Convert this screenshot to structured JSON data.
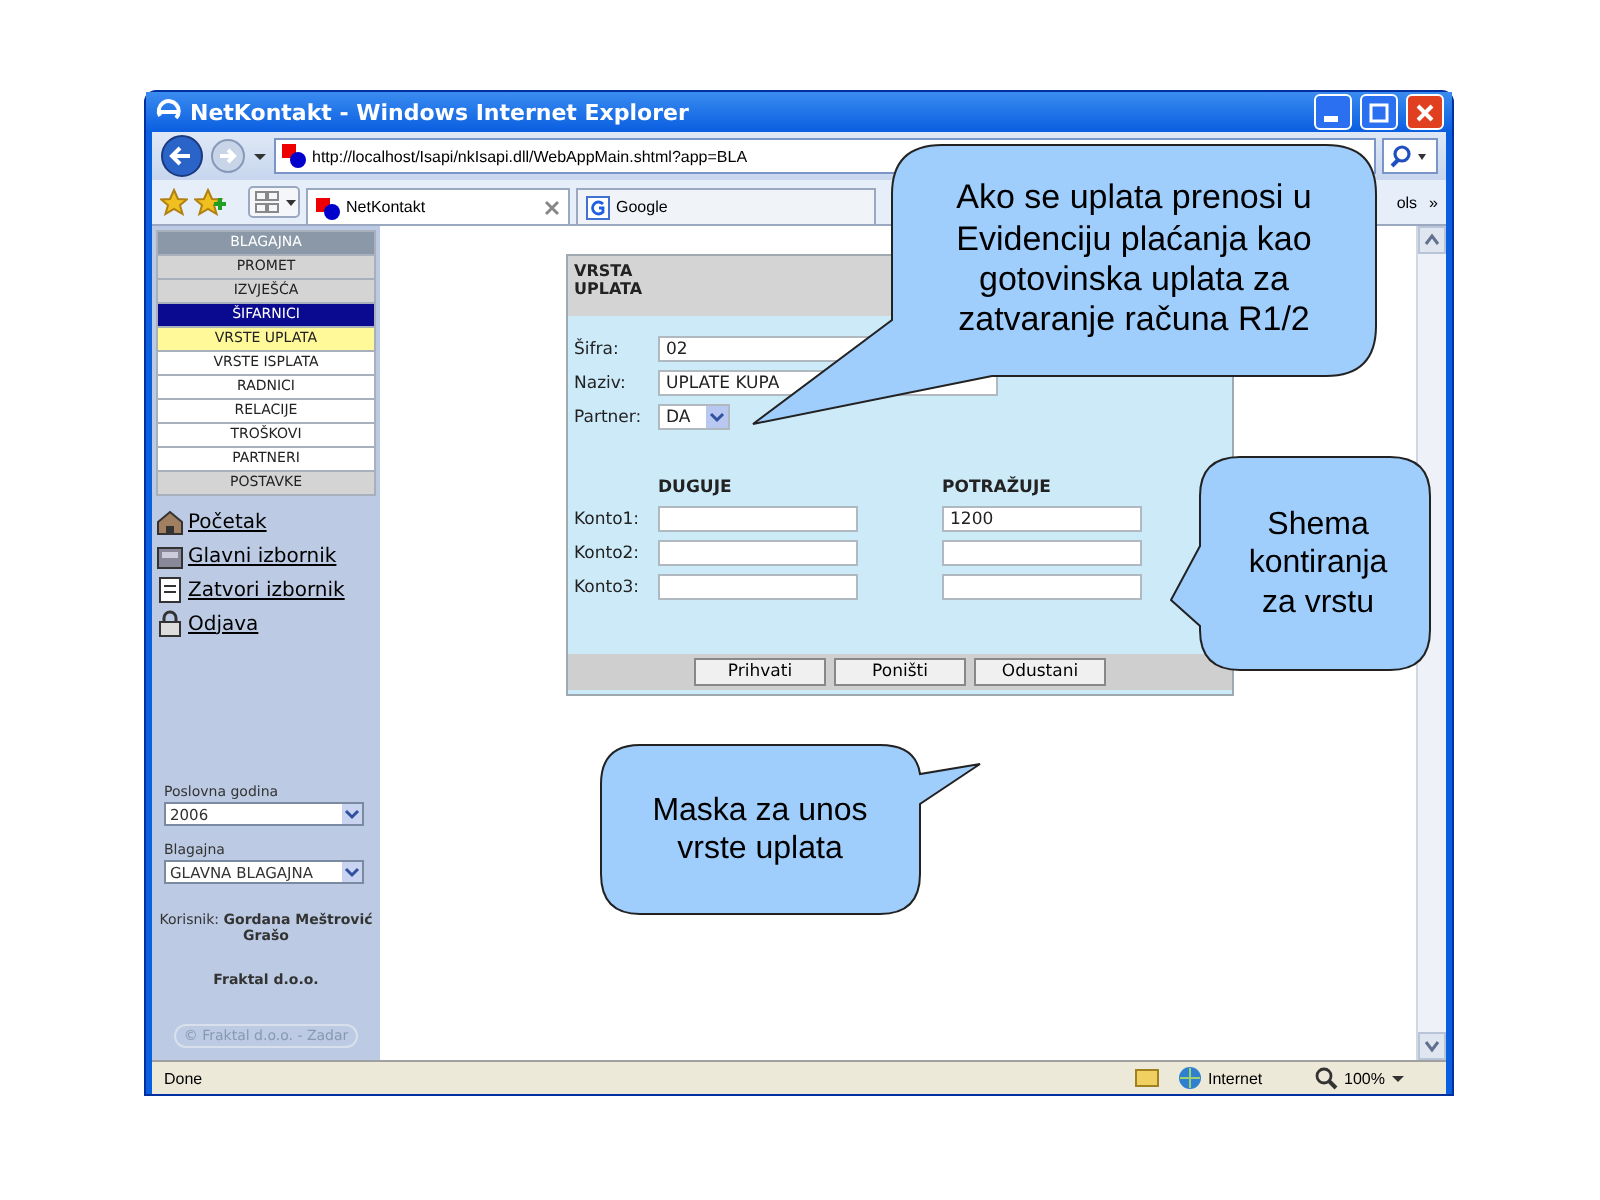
{
  "window": {
    "title": "NetKontakt - Windows Internet Explorer",
    "address": "http://localhost/Isapi/nkIsapi.dll/WebAppMain.shtml?app=BLA",
    "tabs": [
      {
        "label": "NetKontakt",
        "selected": true
      },
      {
        "label": "Google",
        "selected": false
      }
    ],
    "toolbar_text": "ols",
    "chevron": "»"
  },
  "sidebar": {
    "menu": [
      {
        "label": "BLAGAJNA",
        "kind": "header",
        "selected": false
      },
      {
        "label": "PROMET",
        "kind": "section",
        "selected": false
      },
      {
        "label": "IZVJEŠĆA",
        "kind": "section",
        "selected": false
      },
      {
        "label": "ŠIFARNICI",
        "kind": "section",
        "selected": true
      },
      {
        "label": "VRSTE UPLATA",
        "kind": "item",
        "selected": true
      },
      {
        "label": "VRSTE ISPLATA",
        "kind": "item",
        "selected": false
      },
      {
        "label": "RADNICI",
        "kind": "item",
        "selected": false
      },
      {
        "label": "RELACIJE",
        "kind": "item",
        "selected": false
      },
      {
        "label": "TROŠKOVI",
        "kind": "item",
        "selected": false
      },
      {
        "label": "PARTNERI",
        "kind": "item",
        "selected": false
      },
      {
        "label": "POSTAVKE",
        "kind": "section",
        "selected": false
      }
    ],
    "links": [
      {
        "label": "Početak",
        "kind": "home"
      },
      {
        "label": "Glavni izbornik",
        "kind": "menu"
      },
      {
        "label": "Zatvori izbornik",
        "kind": "close"
      },
      {
        "label": "Odjava",
        "kind": "logout"
      }
    ],
    "year": {
      "label": "Poslovna godina",
      "value": "2006"
    },
    "cashbox": {
      "label": "Blagajna",
      "value": "GLAVNA BLAGAJNA"
    },
    "user": "Korisnik: **Gordana Meštrović Grašo**",
    "company": "Fraktal d.o.o.",
    "copyright": "© Fraktal d.o.o. - Zadar"
  },
  "form": {
    "title": "VRSTA UPLATA",
    "fields": [
      {
        "label": "Šifra:",
        "value": "02",
        "kind": "text"
      },
      {
        "label": "Naziv:",
        "value": "UPLATE KUPA",
        "kind": "text"
      },
      {
        "label": "Partner:",
        "value": "DA",
        "kind": "select"
      }
    ],
    "columns": [
      "DUGUJE",
      "POTRAŽUJE"
    ],
    "rows": [
      {
        "label": "Konto1:",
        "potrazuje": "1200"
      },
      {
        "label": "Konto2:"
      },
      {
        "label": "Konto3:"
      }
    ],
    "buttons": [
      "Prihvati",
      "Poništi",
      "Odustani"
    ]
  },
  "status_bar": {
    "text": "Done",
    "zone": "Internet",
    "zoom": "100%"
  },
  "callouts": [
    "Ako se uplata prenosi u Evidenciju plaćanja kao gotovinska uplata za zatvaranje računa R1/2",
    "Shema kontiranja za vrstu",
    "Maska za unos vrste uplata"
  ]
}
